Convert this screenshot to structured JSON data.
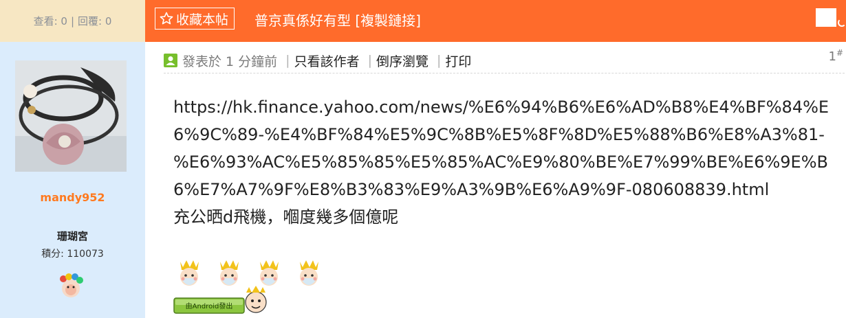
{
  "header": {
    "views_label": "查看: 0",
    "separator": "|",
    "replies_label": "回覆: 0",
    "favorite_label": "收藏本帖",
    "thread_title": "普京真係好有型",
    "copy_link_label": "[複製鏈接]"
  },
  "author": {
    "username": "mandy952",
    "group": "珊瑚宮",
    "points_label": "積分: 110073"
  },
  "post": {
    "posted_label": "發表於 1 分鐘前",
    "only_author_label": "只看該作者",
    "reverse_label": "倒序瀏覽",
    "print_label": "打印",
    "floor_number": "1",
    "floor_mark": "#",
    "url_text": "https://hk.finance.yahoo.com/news/%E6%94%B6%E6%AD%B8%E4%BF%84%E6%9C%89-%E4%BF%84%E5%9C%8B%E5%8F%8D%E5%88%B6%E8%A3%81-%E6%93%AC%E5%85%85%E5%85%AC%E9%80%BE%E7%99%BE%E6%9E%B6%E7%A7%9F%E8%B3%83%E9%A3%9B%E6%A9%9F-080608839.html",
    "message_text": "充公晒d飛機，嗰度幾多個億呢",
    "emoticon_icons": [
      "crowned-baby-emoticon",
      "crowned-baby-emoticon",
      "crowned-baby-emoticon",
      "crowned-baby-emoticon"
    ],
    "android_badge_text": "由Android發出"
  },
  "colors": {
    "title_bar": "#ff6b2b",
    "stats_bg": "#f7e7c3",
    "author_bg": "#dbecfc",
    "username": "#ff7a20",
    "android_green": "#8cc63f"
  }
}
